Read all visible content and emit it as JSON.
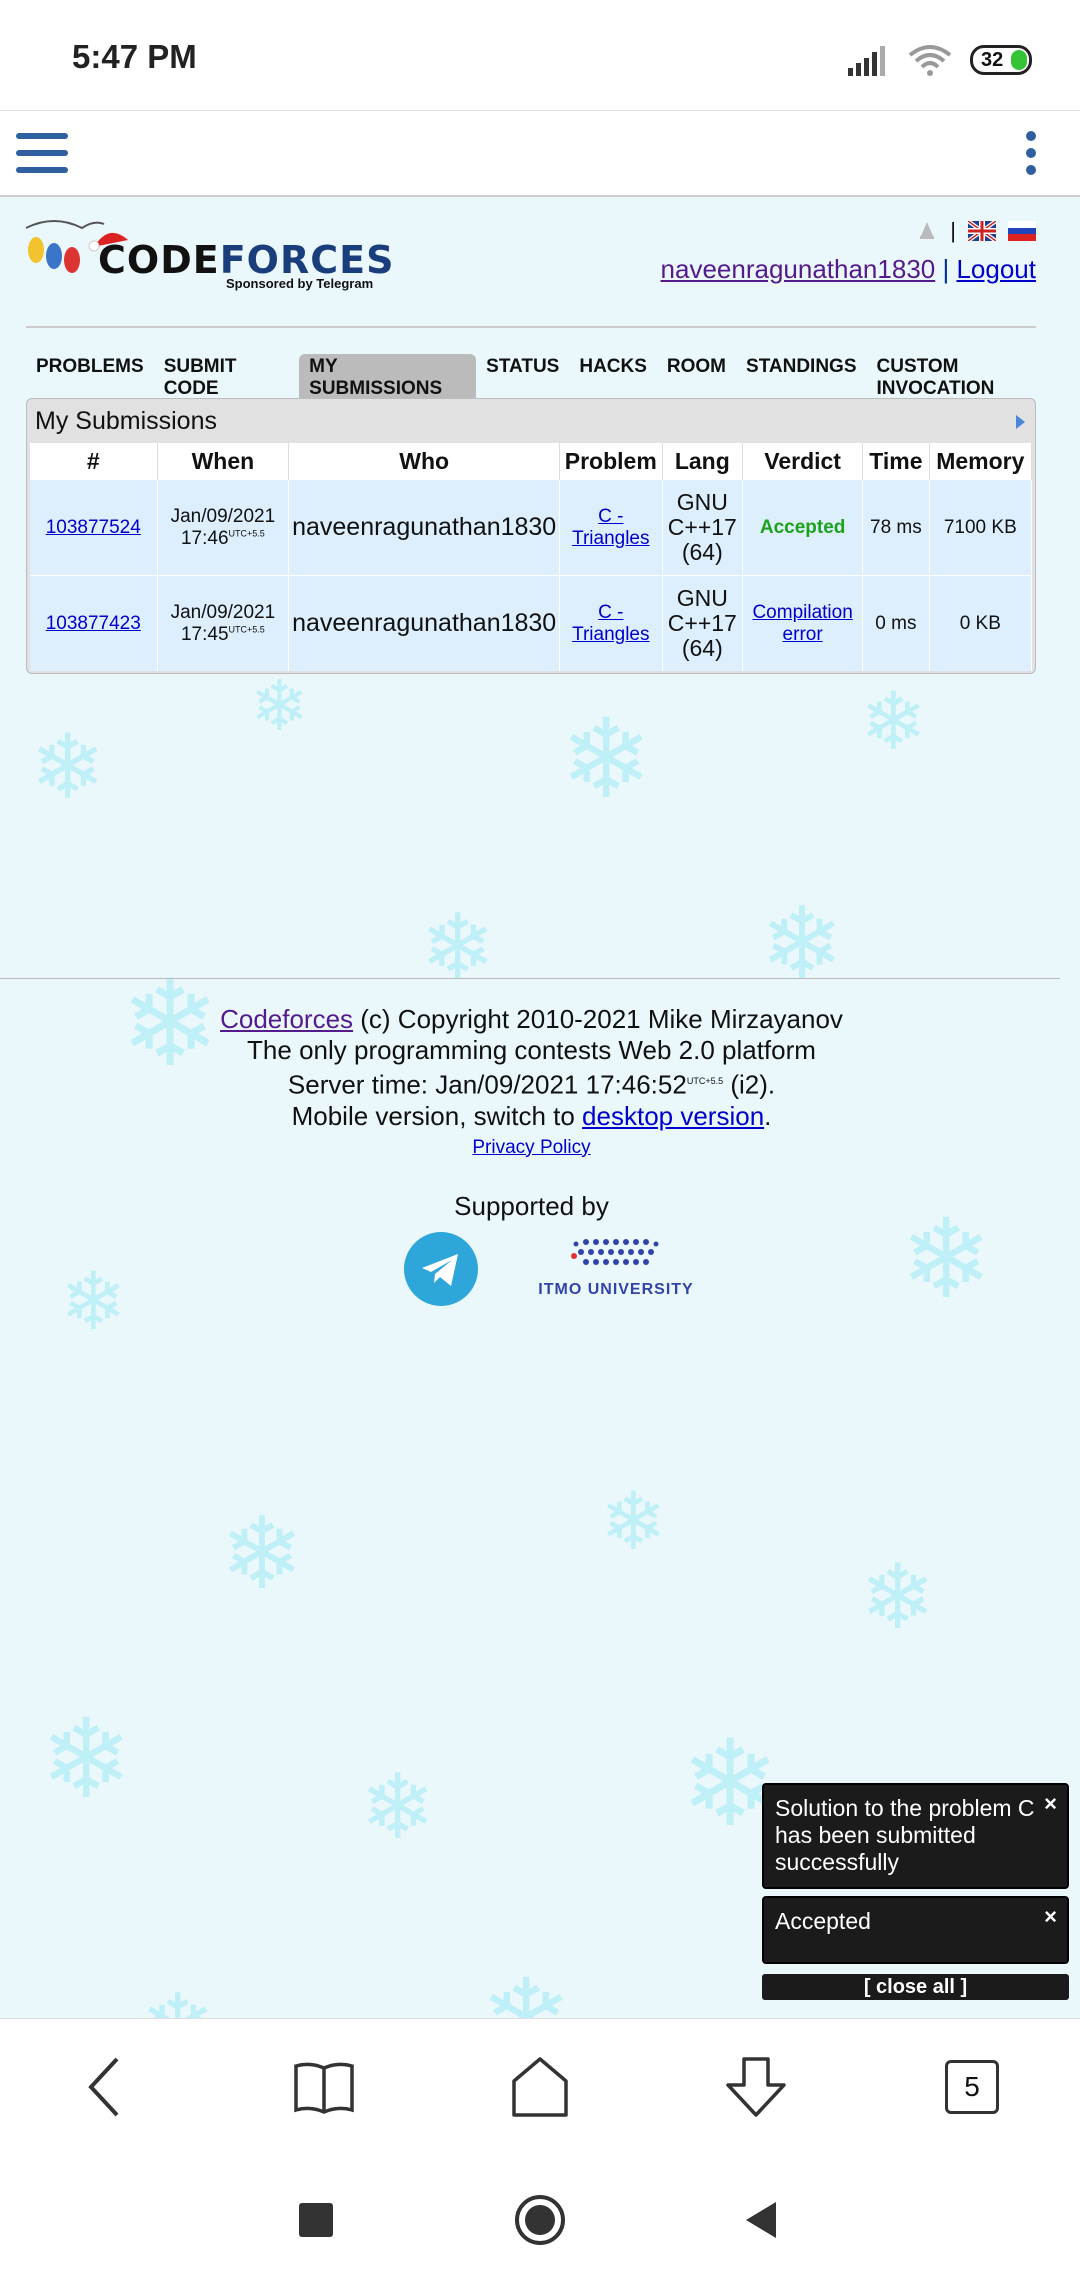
{
  "status_bar": {
    "time": "5:47 PM",
    "battery": "32"
  },
  "header": {
    "logo_text_code": "CODE",
    "logo_text_forces": "FORCES",
    "logo_sponsor": "Sponsored by Telegram",
    "separator": "|",
    "username": "naveenragunathan1830",
    "logout": "Logout"
  },
  "menu": [
    {
      "label": "PROBLEMS",
      "active": false
    },
    {
      "label": "SUBMIT CODE",
      "active": false
    },
    {
      "label": "MY SUBMISSIONS",
      "active": true
    },
    {
      "label": "STATUS",
      "active": false
    },
    {
      "label": "HACKS",
      "active": false
    },
    {
      "label": "ROOM",
      "active": false
    },
    {
      "label": "STANDINGS",
      "active": false
    },
    {
      "label": "CUSTOM INVOCATION",
      "active": false
    }
  ],
  "submissions": {
    "title": "My Submissions",
    "columns": [
      "#",
      "When",
      "Who",
      "Problem",
      "Lang",
      "Verdict",
      "Time",
      "Memory"
    ],
    "rows": [
      {
        "id": "103877524",
        "date": "Jan/09/2021",
        "time": "17:46",
        "tz": "UTC+5.5",
        "who": "naveenragunathan1830",
        "problem": "C - Triangles",
        "lang": "GNU C++17 (64)",
        "verdict": "Accepted",
        "exec_time": "78 ms",
        "memory": "7100 KB"
      },
      {
        "id": "103877423",
        "date": "Jan/09/2021",
        "time": "17:45",
        "tz": "UTC+5.5",
        "who": "naveenragunathan1830",
        "problem": "C - Triangles",
        "lang": "GNU C++17 (64)",
        "verdict": "Compilation error",
        "exec_time": "0 ms",
        "memory": "0 KB"
      }
    ]
  },
  "footer": {
    "codeforces": "Codeforces",
    "copyright": " (c) Copyright 2010-2021 Mike Mirzayanov",
    "tagline": "The only programming contests Web 2.0 platform",
    "server_time_prefix": "Server time: Jan/09/2021 17:46:52",
    "server_tz": "UTC+5.5",
    "server_suffix": " (i2).",
    "mobile_prefix": "Mobile version, switch to ",
    "desktop_link": "desktop version",
    "mobile_suffix": ".",
    "privacy": "Privacy Policy",
    "supported_by": "Supported by",
    "itmo": "ITMO UNIVERSITY"
  },
  "toasts": [
    {
      "text": "Solution to the problem C has been submitted successfully",
      "close": "×"
    },
    {
      "text": "Accepted",
      "close": "×"
    }
  ],
  "close_all": "[ close all ]",
  "browser": {
    "tab_count": "5"
  },
  "colors": {
    "link": "#0000cc",
    "visited": "#551a8b",
    "accepted": "#1ca21c",
    "row_bg": "#ddeefd",
    "nav_icon": "#2f5f9e"
  }
}
